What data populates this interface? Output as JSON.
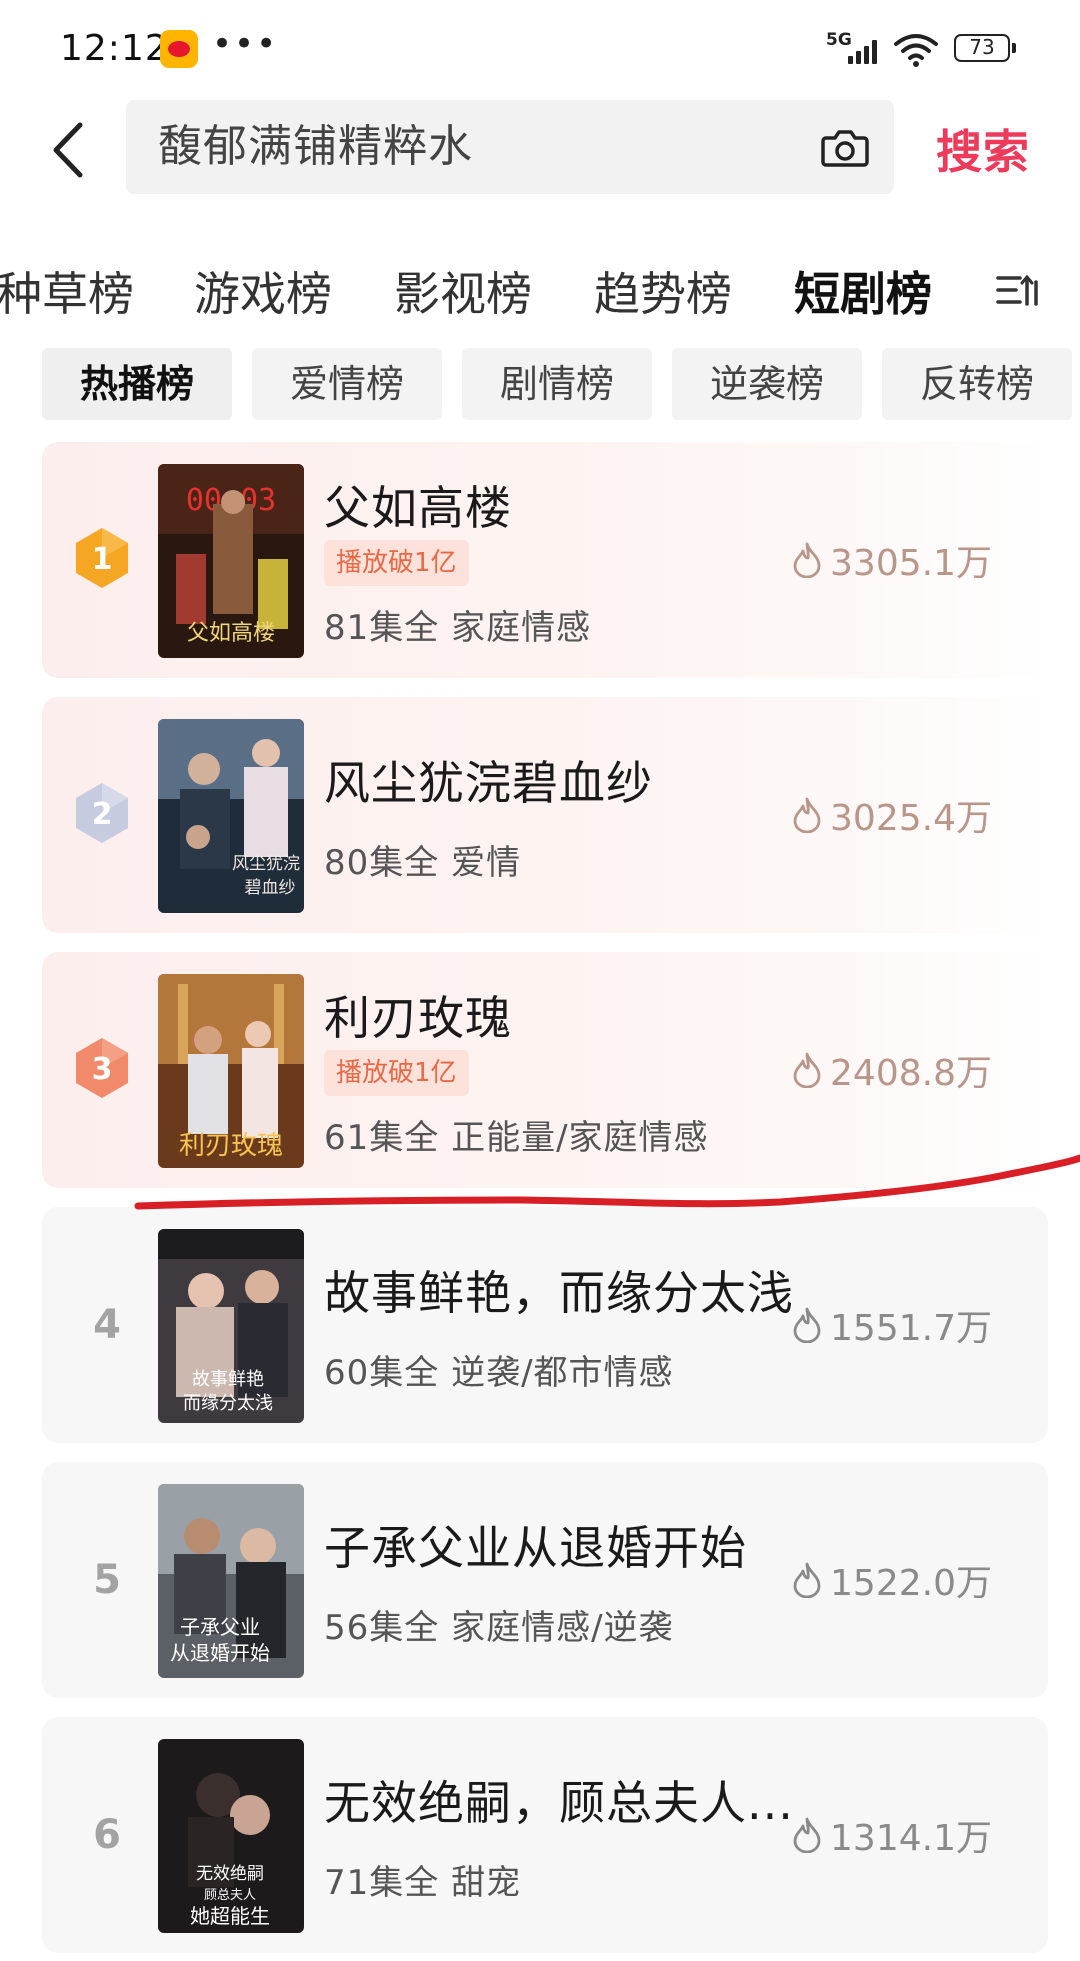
{
  "status_bar": {
    "time": "12:12",
    "network": "5G",
    "battery": "73"
  },
  "search": {
    "query": "馥郁满铺精粹水",
    "submit_label": "搜索"
  },
  "category_tabs": [
    "种草榜",
    "游戏榜",
    "影视榜",
    "趋势榜",
    "短剧榜"
  ],
  "active_category": "短剧榜",
  "sub_tabs": [
    "热播榜",
    "爱情榜",
    "剧情榜",
    "逆袭榜",
    "反转榜"
  ],
  "active_sub_tab": "热播榜",
  "ranking": [
    {
      "rank": "1",
      "title": "父如高楼",
      "tag": "播放破1亿",
      "meta": "81集全  家庭情感",
      "heat": "3305.1万"
    },
    {
      "rank": "2",
      "title": "风尘犹浣碧血纱",
      "tag": "",
      "meta": "80集全  爱情",
      "heat": "3025.4万"
    },
    {
      "rank": "3",
      "title": "利刃玫瑰",
      "tag": "播放破1亿",
      "meta": "61集全  正能量/家庭情感",
      "heat": "2408.8万"
    },
    {
      "rank": "4",
      "title": "故事鲜艳，而缘分太浅",
      "tag": "",
      "meta": "60集全  逆袭/都市情感",
      "heat": "1551.7万"
    },
    {
      "rank": "5",
      "title": "子承父业从退婚开始",
      "tag": "",
      "meta": "56集全  家庭情感/逆袭",
      "heat": "1522.0万"
    },
    {
      "rank": "6",
      "title": "无效绝嗣，顾总夫人...",
      "tag": "",
      "meta": "71集全  甜宠",
      "heat": "1314.1万"
    }
  ],
  "colors": {
    "accent": "#ee3b5c",
    "gold": "#f5a623",
    "silver": "#c7cbe0",
    "bronze": "#f08a6a"
  }
}
